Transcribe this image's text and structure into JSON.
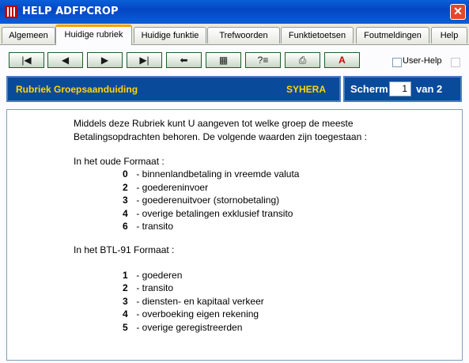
{
  "window": {
    "title": "HELP ADFPCROP",
    "close_glyph": "✕"
  },
  "tabs": [
    {
      "label": "Algemeen"
    },
    {
      "label": "Huidige rubriek",
      "active": true
    },
    {
      "label": "Huidige funktie"
    },
    {
      "label": "Trefwoorden"
    },
    {
      "label": "Funktietoetsen"
    },
    {
      "label": "Foutmeldingen"
    },
    {
      "label": "Help"
    }
  ],
  "toolbar": {
    "buttons": [
      {
        "name": "first-page-button",
        "icon": "first-icon",
        "glyph": "|◀"
      },
      {
        "name": "previous-page-button",
        "icon": "previous-icon",
        "glyph": "◀"
      },
      {
        "name": "next-page-button",
        "icon": "next-icon",
        "glyph": "▶"
      },
      {
        "name": "last-page-button",
        "icon": "last-icon",
        "glyph": "▶|"
      },
      {
        "name": "back-button",
        "icon": "back-arrow-icon",
        "glyph": "⬅"
      },
      {
        "name": "index-button",
        "icon": "index-book-icon",
        "glyph": "▦"
      },
      {
        "name": "info-button",
        "icon": "info-card-icon",
        "glyph": "?≡"
      },
      {
        "name": "print-button",
        "icon": "printer-icon",
        "glyph": "⎙"
      },
      {
        "name": "font-button",
        "icon": "font-icon",
        "glyph": "A"
      }
    ],
    "user_help_label": "User-Help"
  },
  "header": {
    "title": "Rubriek Groepsaanduiding",
    "code": "SYHERA"
  },
  "scherm": {
    "label": "Scherm",
    "current": "1",
    "van": "van 2"
  },
  "content": {
    "intro1": "Middels deze Rubriek kunt U aangeven tot welke groep de meeste",
    "intro2": "Betalingsopdrachten behoren. De volgende waarden zijn toegestaan :",
    "old_format_heading": "In het oude Formaat :",
    "old_items": [
      {
        "code": "0",
        "text": " - binnenlandbetaling in vreemde valuta"
      },
      {
        "code": "2",
        "text": " - goedereninvoer"
      },
      {
        "code": "3",
        "text": " - goederenuitvoer (stornobetaling)"
      },
      {
        "code": "4",
        "text": " - overige betalingen exklusief transito"
      },
      {
        "code": "6",
        "text": " - transito"
      }
    ],
    "btl_format_heading": "In het BTL-91 Formaat :",
    "btl_items": [
      {
        "code": "1",
        "text": " - goederen"
      },
      {
        "code": "2",
        "text": " - transito"
      },
      {
        "code": "3",
        "text": " - diensten- en kapitaal verkeer"
      },
      {
        "code": "4",
        "text": " - overboeking eigen rekening"
      },
      {
        "code": "5",
        "text": " - overige geregistreerden"
      }
    ]
  },
  "colors": {
    "titlebar": "#0a5fd8",
    "header_bg": "#0a4a9a",
    "header_text": "#ffd700",
    "active_tab_accent": "#f5a000"
  }
}
